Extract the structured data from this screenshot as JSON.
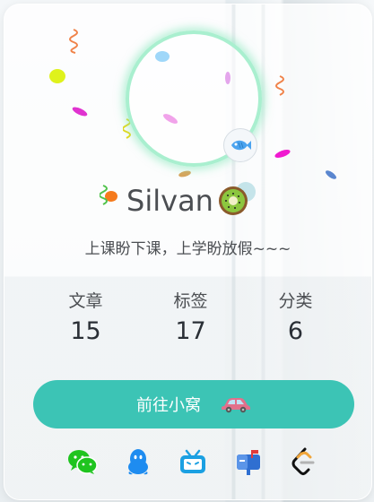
{
  "profile": {
    "name": "Silvan",
    "bio": "上课盼下课，上学盼放假~~~"
  },
  "stats": [
    {
      "label": "文章",
      "value": "15"
    },
    {
      "label": "标签",
      "value": "17"
    },
    {
      "label": "分类",
      "value": "6"
    }
  ],
  "action": {
    "label": "前往小窝"
  },
  "icons": {
    "avatar_badge": "fish-icon",
    "name_decoration": "kiwi-icon",
    "button_icon": "car-icon",
    "socials": [
      "wechat-icon",
      "qq-icon",
      "bilibili-icon",
      "mailbox-icon",
      "leetcode-icon"
    ]
  },
  "colors": {
    "accent": "#3cc4b5",
    "ring": "#a9efcf",
    "text": "#4b4e52"
  }
}
